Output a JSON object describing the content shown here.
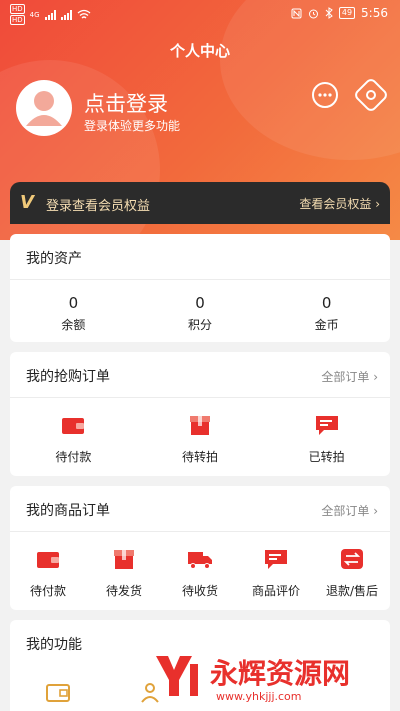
{
  "status_bar": {
    "sim1": "HD",
    "sim2": "HD",
    "signal": "4G",
    "battery": "49",
    "time": "5:56"
  },
  "header": {
    "title": "个人中心",
    "login_title": "点击登录",
    "login_sub": "登录体验更多功能"
  },
  "vip": {
    "badge": "V",
    "text": "登录查看会员权益",
    "link": "查看会员权益 ›"
  },
  "assets": {
    "title": "我的资产",
    "items": [
      {
        "value": "0",
        "label": "余额"
      },
      {
        "value": "0",
        "label": "积分"
      },
      {
        "value": "0",
        "label": "金币"
      }
    ]
  },
  "flash_orders": {
    "title": "我的抢购订单",
    "more": "全部订单 ›",
    "items": [
      {
        "label": "待付款",
        "icon": "wallet-icon"
      },
      {
        "label": "待转拍",
        "icon": "box-icon"
      },
      {
        "label": "已转拍",
        "icon": "message-icon"
      }
    ]
  },
  "goods_orders": {
    "title": "我的商品订单",
    "more": "全部订单 ›",
    "items": [
      {
        "label": "待付款",
        "icon": "wallet-icon"
      },
      {
        "label": "待发货",
        "icon": "box-icon"
      },
      {
        "label": "待收货",
        "icon": "truck-icon"
      },
      {
        "label": "商品评价",
        "icon": "comment-icon"
      },
      {
        "label": "退款/售后",
        "icon": "refund-icon"
      }
    ]
  },
  "functions": {
    "title": "我的功能"
  },
  "watermark": {
    "name": "永辉资源网",
    "url": "www.yhkjjj.com"
  },
  "colors": {
    "accent": "#e8302c",
    "header_start": "#f04a3a",
    "header_end": "#f58a46",
    "vip_bg": "#2b2b2b",
    "vip_text": "#f4ddb2"
  }
}
